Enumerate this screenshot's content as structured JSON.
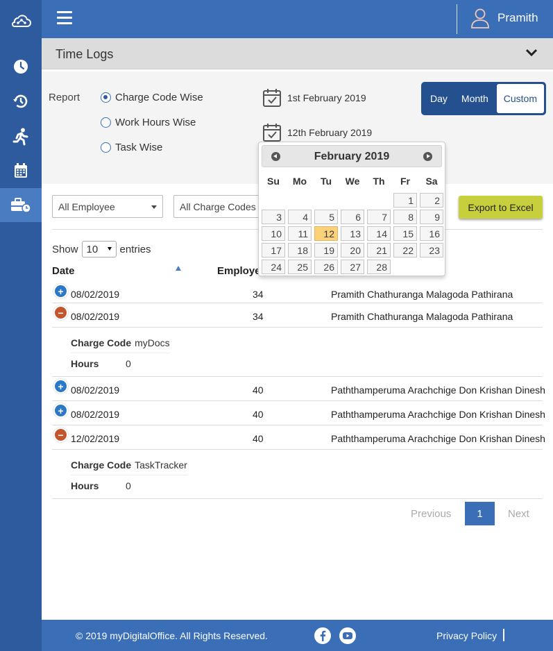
{
  "app": {
    "user_name": "Pramith"
  },
  "sidebar": {
    "items": [
      {
        "icon": "clock-icon"
      },
      {
        "icon": "history-icon"
      },
      {
        "icon": "running-man-icon"
      },
      {
        "icon": "calendar-icon"
      },
      {
        "icon": "briefcase-clock-icon"
      }
    ]
  },
  "section": {
    "title": "Time Logs"
  },
  "filters": {
    "report_label": "Report",
    "options": [
      "Charge Code Wise",
      "Work Hours Wise",
      "Task Wise"
    ],
    "selected": "Charge Code Wise",
    "from_date": "1st February 2019",
    "to_date": "12th February 2019",
    "range_modes": [
      "Day",
      "Month",
      "Custom"
    ],
    "active_mode": "Custom",
    "employee_select": "All Employee",
    "charge_code_select": "All Charge Codes",
    "export_label": "Export to Excel"
  },
  "table": {
    "show_label": "Show",
    "entries_value": "10",
    "entries_label": "entries",
    "headers": {
      "date": "Date",
      "employee": "Employe"
    },
    "rows": [
      {
        "date": "08/02/2019",
        "num": "34",
        "name": "Pramith Chathuranga Malagoda Pathirana",
        "expanded": false
      },
      {
        "date": "08/02/2019",
        "num": "34",
        "name": "Pramith Chathuranga Malagoda Pathirana",
        "expanded": true,
        "charge_code_label": "Charge Code",
        "charge_code": "myDocs",
        "hours_label": "Hours",
        "hours": "0"
      },
      {
        "date": "08/02/2019",
        "num": "40",
        "name": "Paththamperuma Arachchige Don Krishan Dinesh",
        "expanded": false
      },
      {
        "date": "08/02/2019",
        "num": "40",
        "name": "Paththamperuma Arachchige Don Krishan Dinesh",
        "expanded": false
      },
      {
        "date": "12/02/2019",
        "num": "40",
        "name": "Paththamperuma Arachchige Don Krishan Dinesh",
        "expanded": true,
        "charge_code_label": "Charge Code",
        "charge_code": "TaskTracker",
        "hours_label": "Hours",
        "hours": "0"
      }
    ]
  },
  "pagination": {
    "previous": "Previous",
    "page": "1",
    "next": "Next"
  },
  "calendar": {
    "title": "February 2019",
    "weekdays": [
      "Su",
      "Mo",
      "Tu",
      "We",
      "Th",
      "Fr",
      "Sa"
    ],
    "first_weekday_index": 5,
    "days_in_month": 28,
    "highlighted_day": 12
  },
  "footer": {
    "copyright": "© 2019 myDigitalOffice. All Rights Reserved.",
    "privacy": "Privacy Policy"
  },
  "colors": {
    "sidebar": "#2e5b9e",
    "topbar": "#3a6fb8",
    "accent_button": "#c8cf3d",
    "highlight_day": "#fbd27a"
  }
}
